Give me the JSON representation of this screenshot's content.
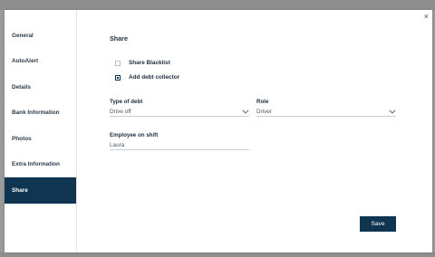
{
  "sidebar": {
    "items": [
      {
        "label": "General"
      },
      {
        "label": "AutoAlert"
      },
      {
        "label": "Details"
      },
      {
        "label": "Bank Information"
      },
      {
        "label": "Photos"
      },
      {
        "label": "Extra Information"
      },
      {
        "label": "Share",
        "active": true
      }
    ]
  },
  "close_label": "×",
  "main": {
    "title": "Share",
    "checkboxes": [
      {
        "label": "Share Blacklist",
        "checked": false
      },
      {
        "label": "Add debt collector",
        "checked": true
      }
    ],
    "type_of_debt": {
      "label": "Type of debt",
      "value": "Drive off"
    },
    "role": {
      "label": "Role",
      "value": "Driver"
    },
    "employee": {
      "label": "Employee on shift",
      "value": "Laura"
    },
    "save_label": "Save"
  },
  "colors": {
    "accent": "#0f3550",
    "backdrop": "#9a9a9a"
  }
}
